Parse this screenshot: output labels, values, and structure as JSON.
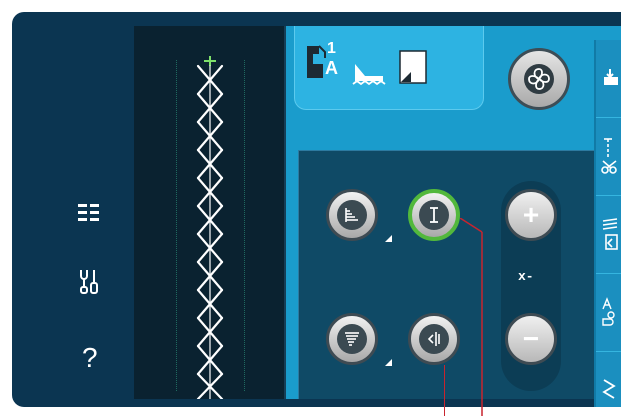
{
  "sidebar": {
    "items": [
      {
        "icon": "stitch-menu-icon"
      },
      {
        "icon": "settings-tools-icon"
      },
      {
        "icon": "help-icon",
        "label": "?"
      }
    ]
  },
  "stitch_preview": {
    "pattern": "cross-stitch-column"
  },
  "top_tile": {
    "presser_foot_label": "1",
    "presser_foot_letter": "A",
    "icons": [
      "presser-foot-icon",
      "feed-dog-icon",
      "stabilizer-icon"
    ]
  },
  "fan_button": {
    "icon": "fan-icon"
  },
  "controls": {
    "stitch_length_icon": "stitch-length-icon",
    "stitch_width_icon": "stitch-width-icon",
    "stitch_density_icon": "stitch-density-icon",
    "stitch_position_icon": "stitch-positioning-icon",
    "plus_label": "+",
    "minus_label": "−",
    "axis_label": "x-"
  },
  "right_strip": {
    "items": [
      "bobbin-icon",
      "tie-off-scissors-icon",
      "tapering-icon",
      "mirror-icon",
      "stitch-repeat-icon"
    ]
  },
  "colors": {
    "frame": "#0b3551",
    "panel": "#1a9ccc",
    "selected": "#52b83c",
    "leader": "#c8242e"
  }
}
